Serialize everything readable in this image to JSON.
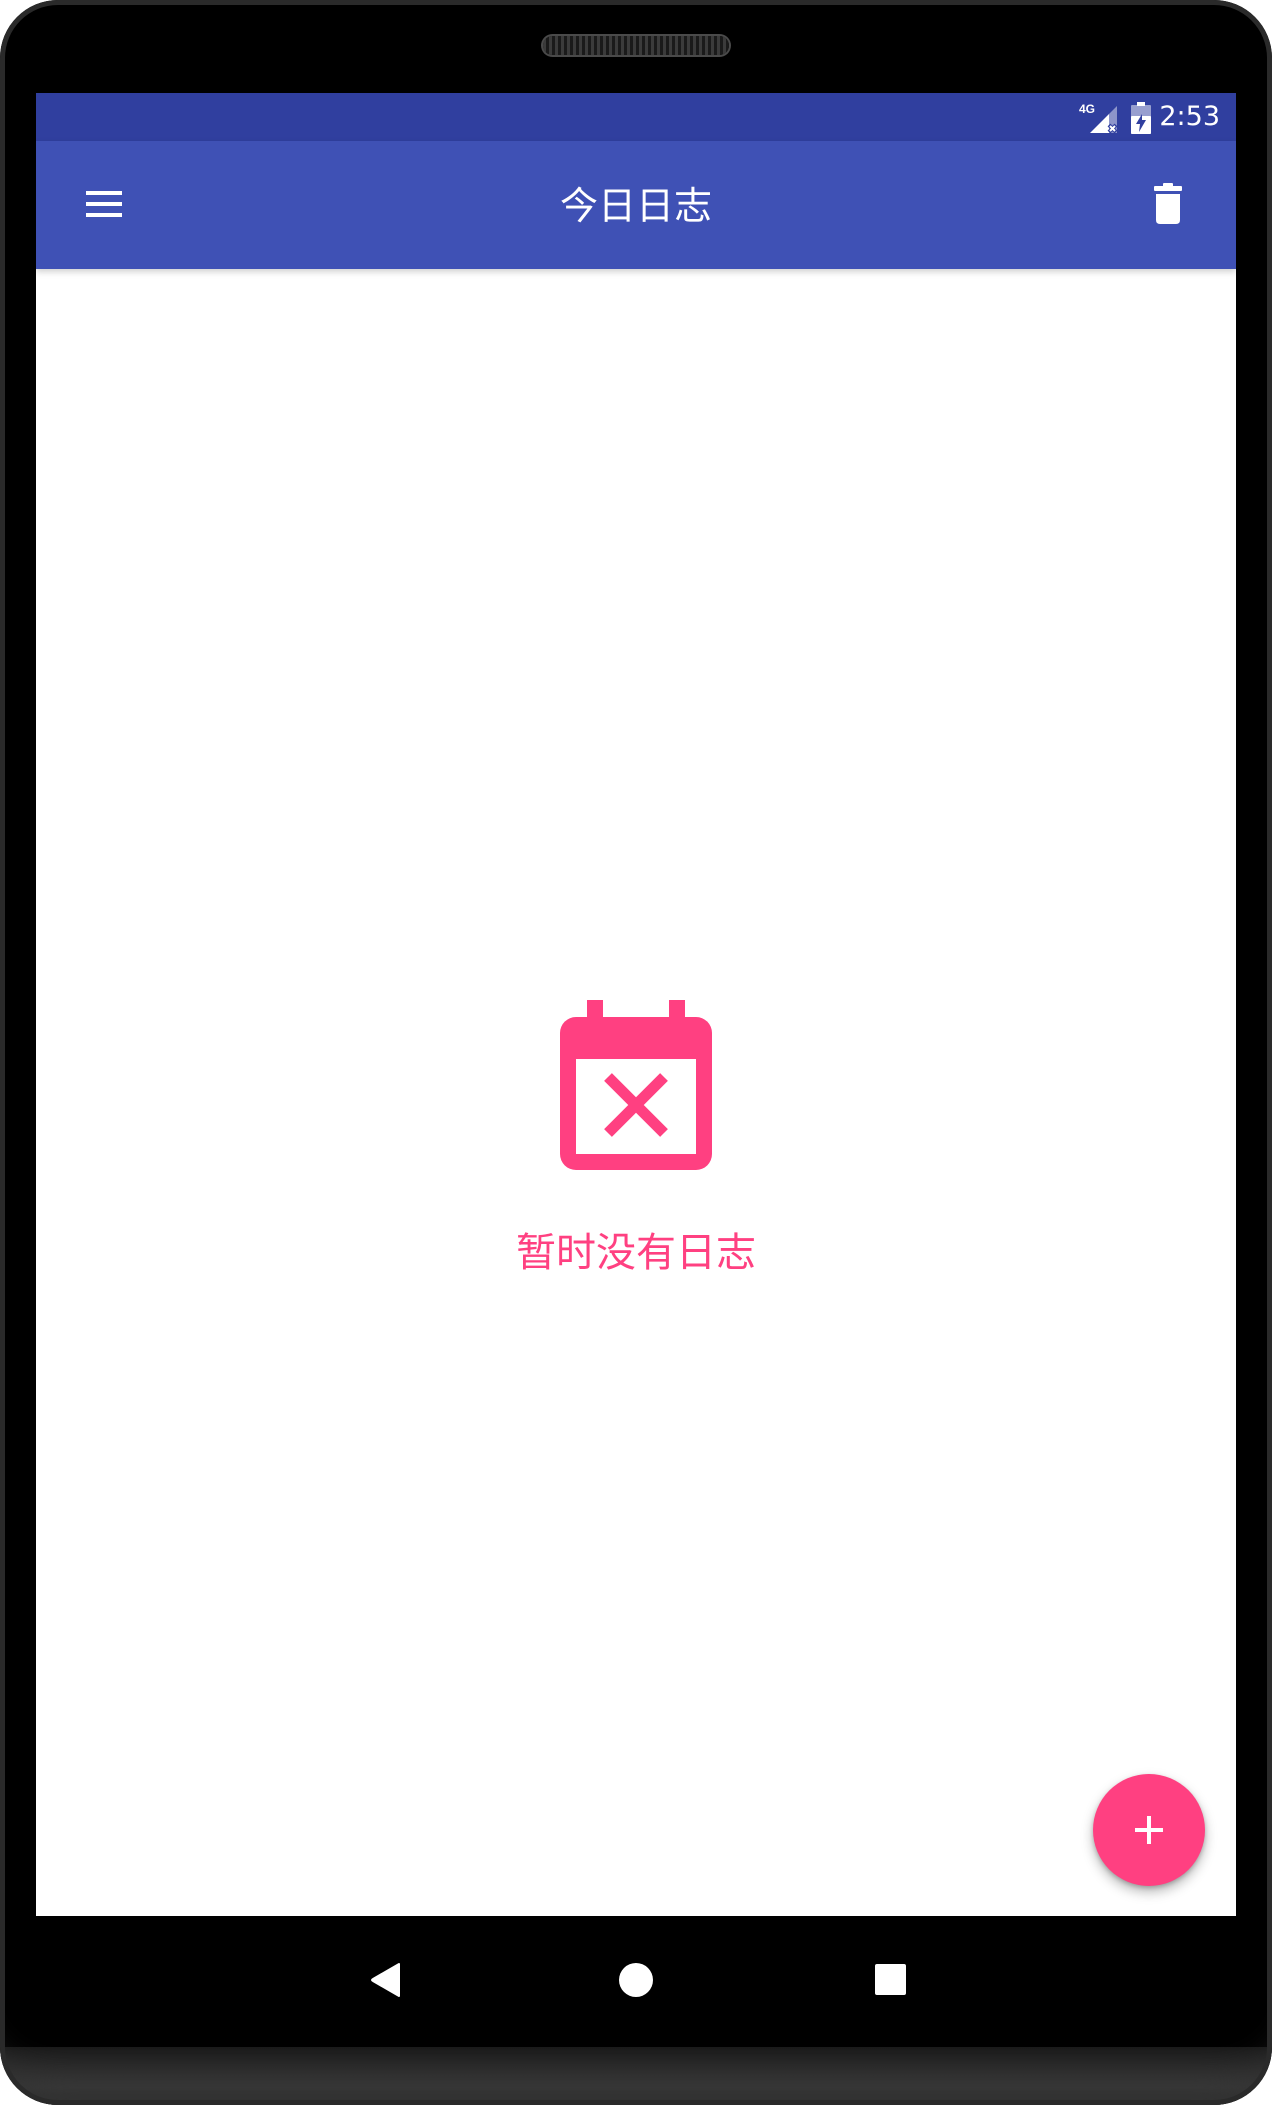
{
  "status_bar": {
    "network_label": "4G",
    "time": "2:53",
    "background": "#303f9f",
    "icons": [
      "signal-4g-no-data-icon",
      "battery-charging-icon"
    ]
  },
  "app_bar": {
    "title": "今日日志",
    "background": "#3f51b5",
    "menu_icon": "menu-icon",
    "delete_icon": "delete-icon"
  },
  "empty_state": {
    "icon": "calendar-remove-icon",
    "message": "暂时没有日志",
    "color": "#ff4081"
  },
  "fab": {
    "icon": "add-icon",
    "color": "#ff4081"
  },
  "nav_bar": {
    "buttons": [
      "back-icon",
      "home-icon",
      "recent-apps-icon"
    ]
  }
}
